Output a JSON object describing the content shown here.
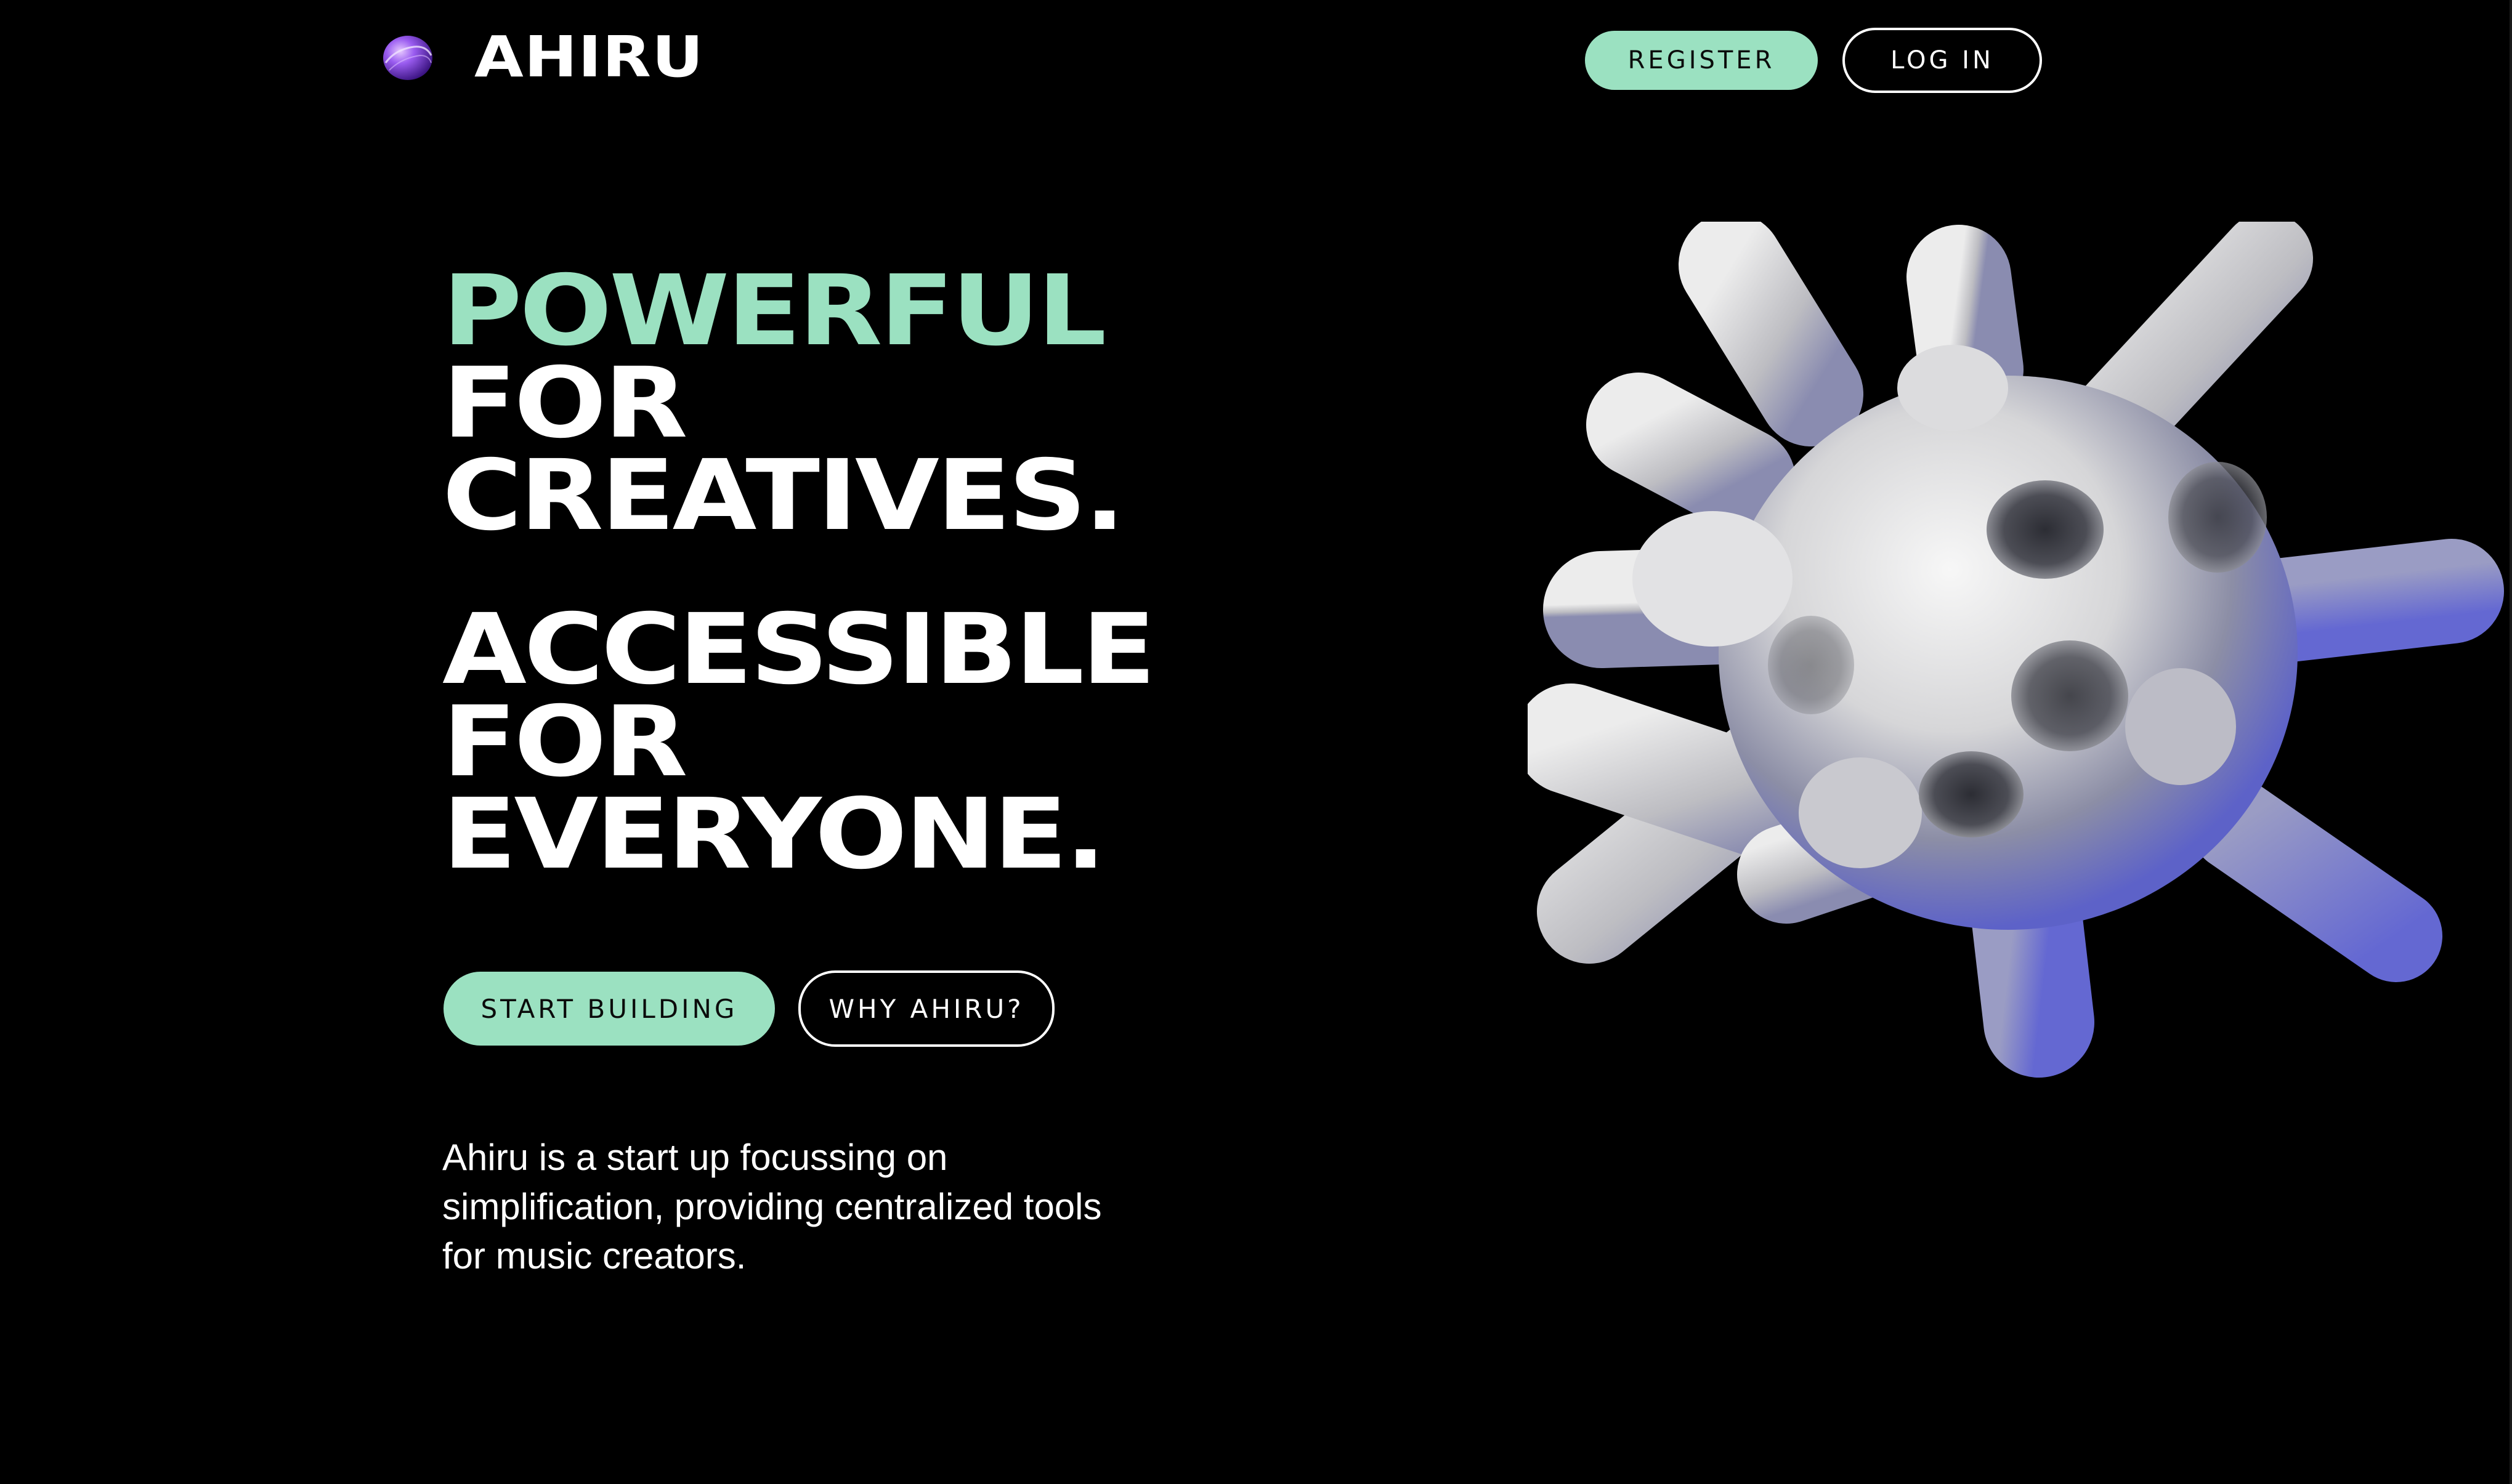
{
  "header": {
    "brand": "AHIRU",
    "logo_icon": "sphere-logo-icon",
    "register_label": "REGISTER",
    "login_label": "LOG IN"
  },
  "hero": {
    "headline_1": [
      "POWERFUL",
      "FOR",
      "CREATIVES."
    ],
    "headline_2": [
      "ACCESSIBLE",
      "FOR",
      "EVERYONE."
    ],
    "start_label": "START BUILDING",
    "why_label": "WHY AHIRU?",
    "description": "Ahiru is a start up focussing on simplification, providing centralized tools for music creators.",
    "illustration_icon": "virus-blob-illustration"
  },
  "colors": {
    "background": "#000000",
    "accent": "#9be1c1",
    "text": "#ffffff",
    "blob_shade": "#6b6fd8"
  }
}
